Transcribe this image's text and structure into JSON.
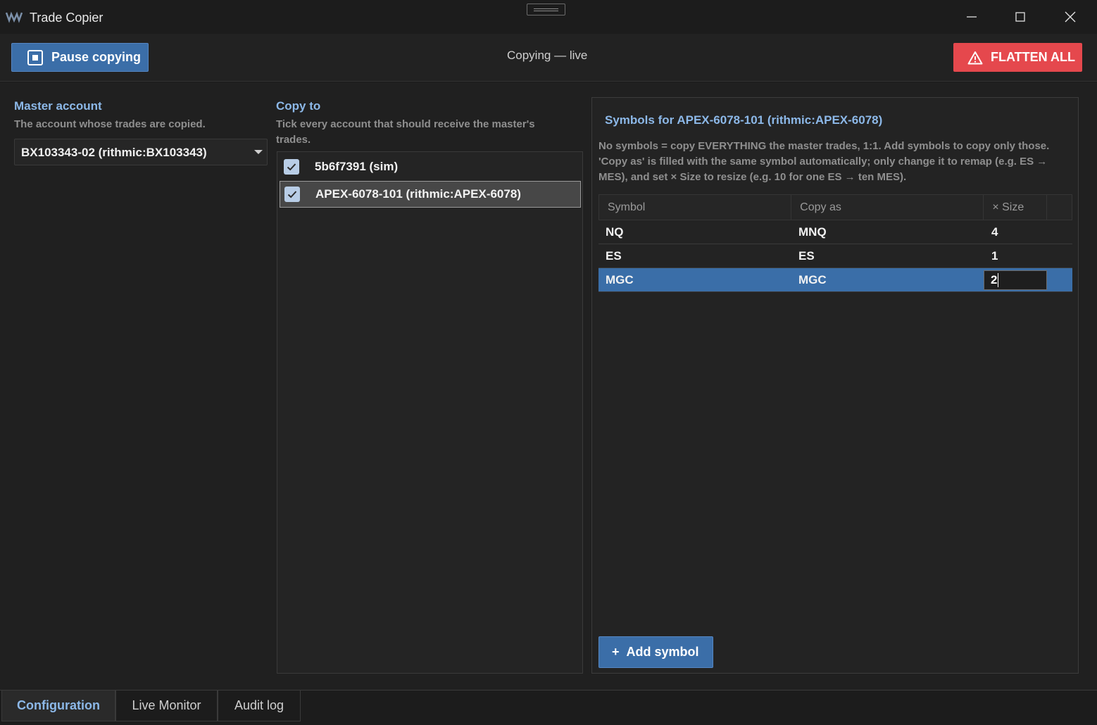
{
  "window": {
    "title": "Trade Copier"
  },
  "toolbar": {
    "pause_label": "Pause copying",
    "status": "Copying — live",
    "flatten_label": "FLATTEN ALL"
  },
  "master": {
    "title": "Master account",
    "subtitle": "The account whose trades are copied.",
    "selected": "BX103343-02  (rithmic:BX103343)"
  },
  "copy_to": {
    "title": "Copy to",
    "subtitle": "Tick every account that should receive the master's trades.",
    "accounts": [
      {
        "label": "5b6f7391  (sim)",
        "checked": true
      },
      {
        "label": "APEX-6078-101  (rithmic:APEX-6078)",
        "checked": true
      }
    ]
  },
  "symbols": {
    "title": "Symbols for APEX-6078-101  (rithmic:APEX-6078)",
    "description": "No symbols = copy EVERYTHING the master trades, 1:1. Add symbols to copy only those. 'Copy as' is filled with the same symbol automatically; only change it to remap (e.g. ES → MES), and set × Size to resize (e.g. 10 for one ES → ten MES).",
    "headers": [
      "Symbol",
      "Copy as",
      "× Size"
    ],
    "rows": [
      {
        "symbol": "NQ",
        "copy_as": "MNQ",
        "size": "4"
      },
      {
        "symbol": "ES",
        "copy_as": "ES",
        "size": "1"
      },
      {
        "symbol": "MGC",
        "copy_as": "MGC",
        "size": "2"
      }
    ],
    "add_label": "Add symbol"
  },
  "tabs": [
    "Configuration",
    "Live Monitor",
    "Audit log"
  ],
  "colors": {
    "accent": "#3b6ea8",
    "danger": "#e5484d",
    "heading": "#8cb8e8"
  }
}
